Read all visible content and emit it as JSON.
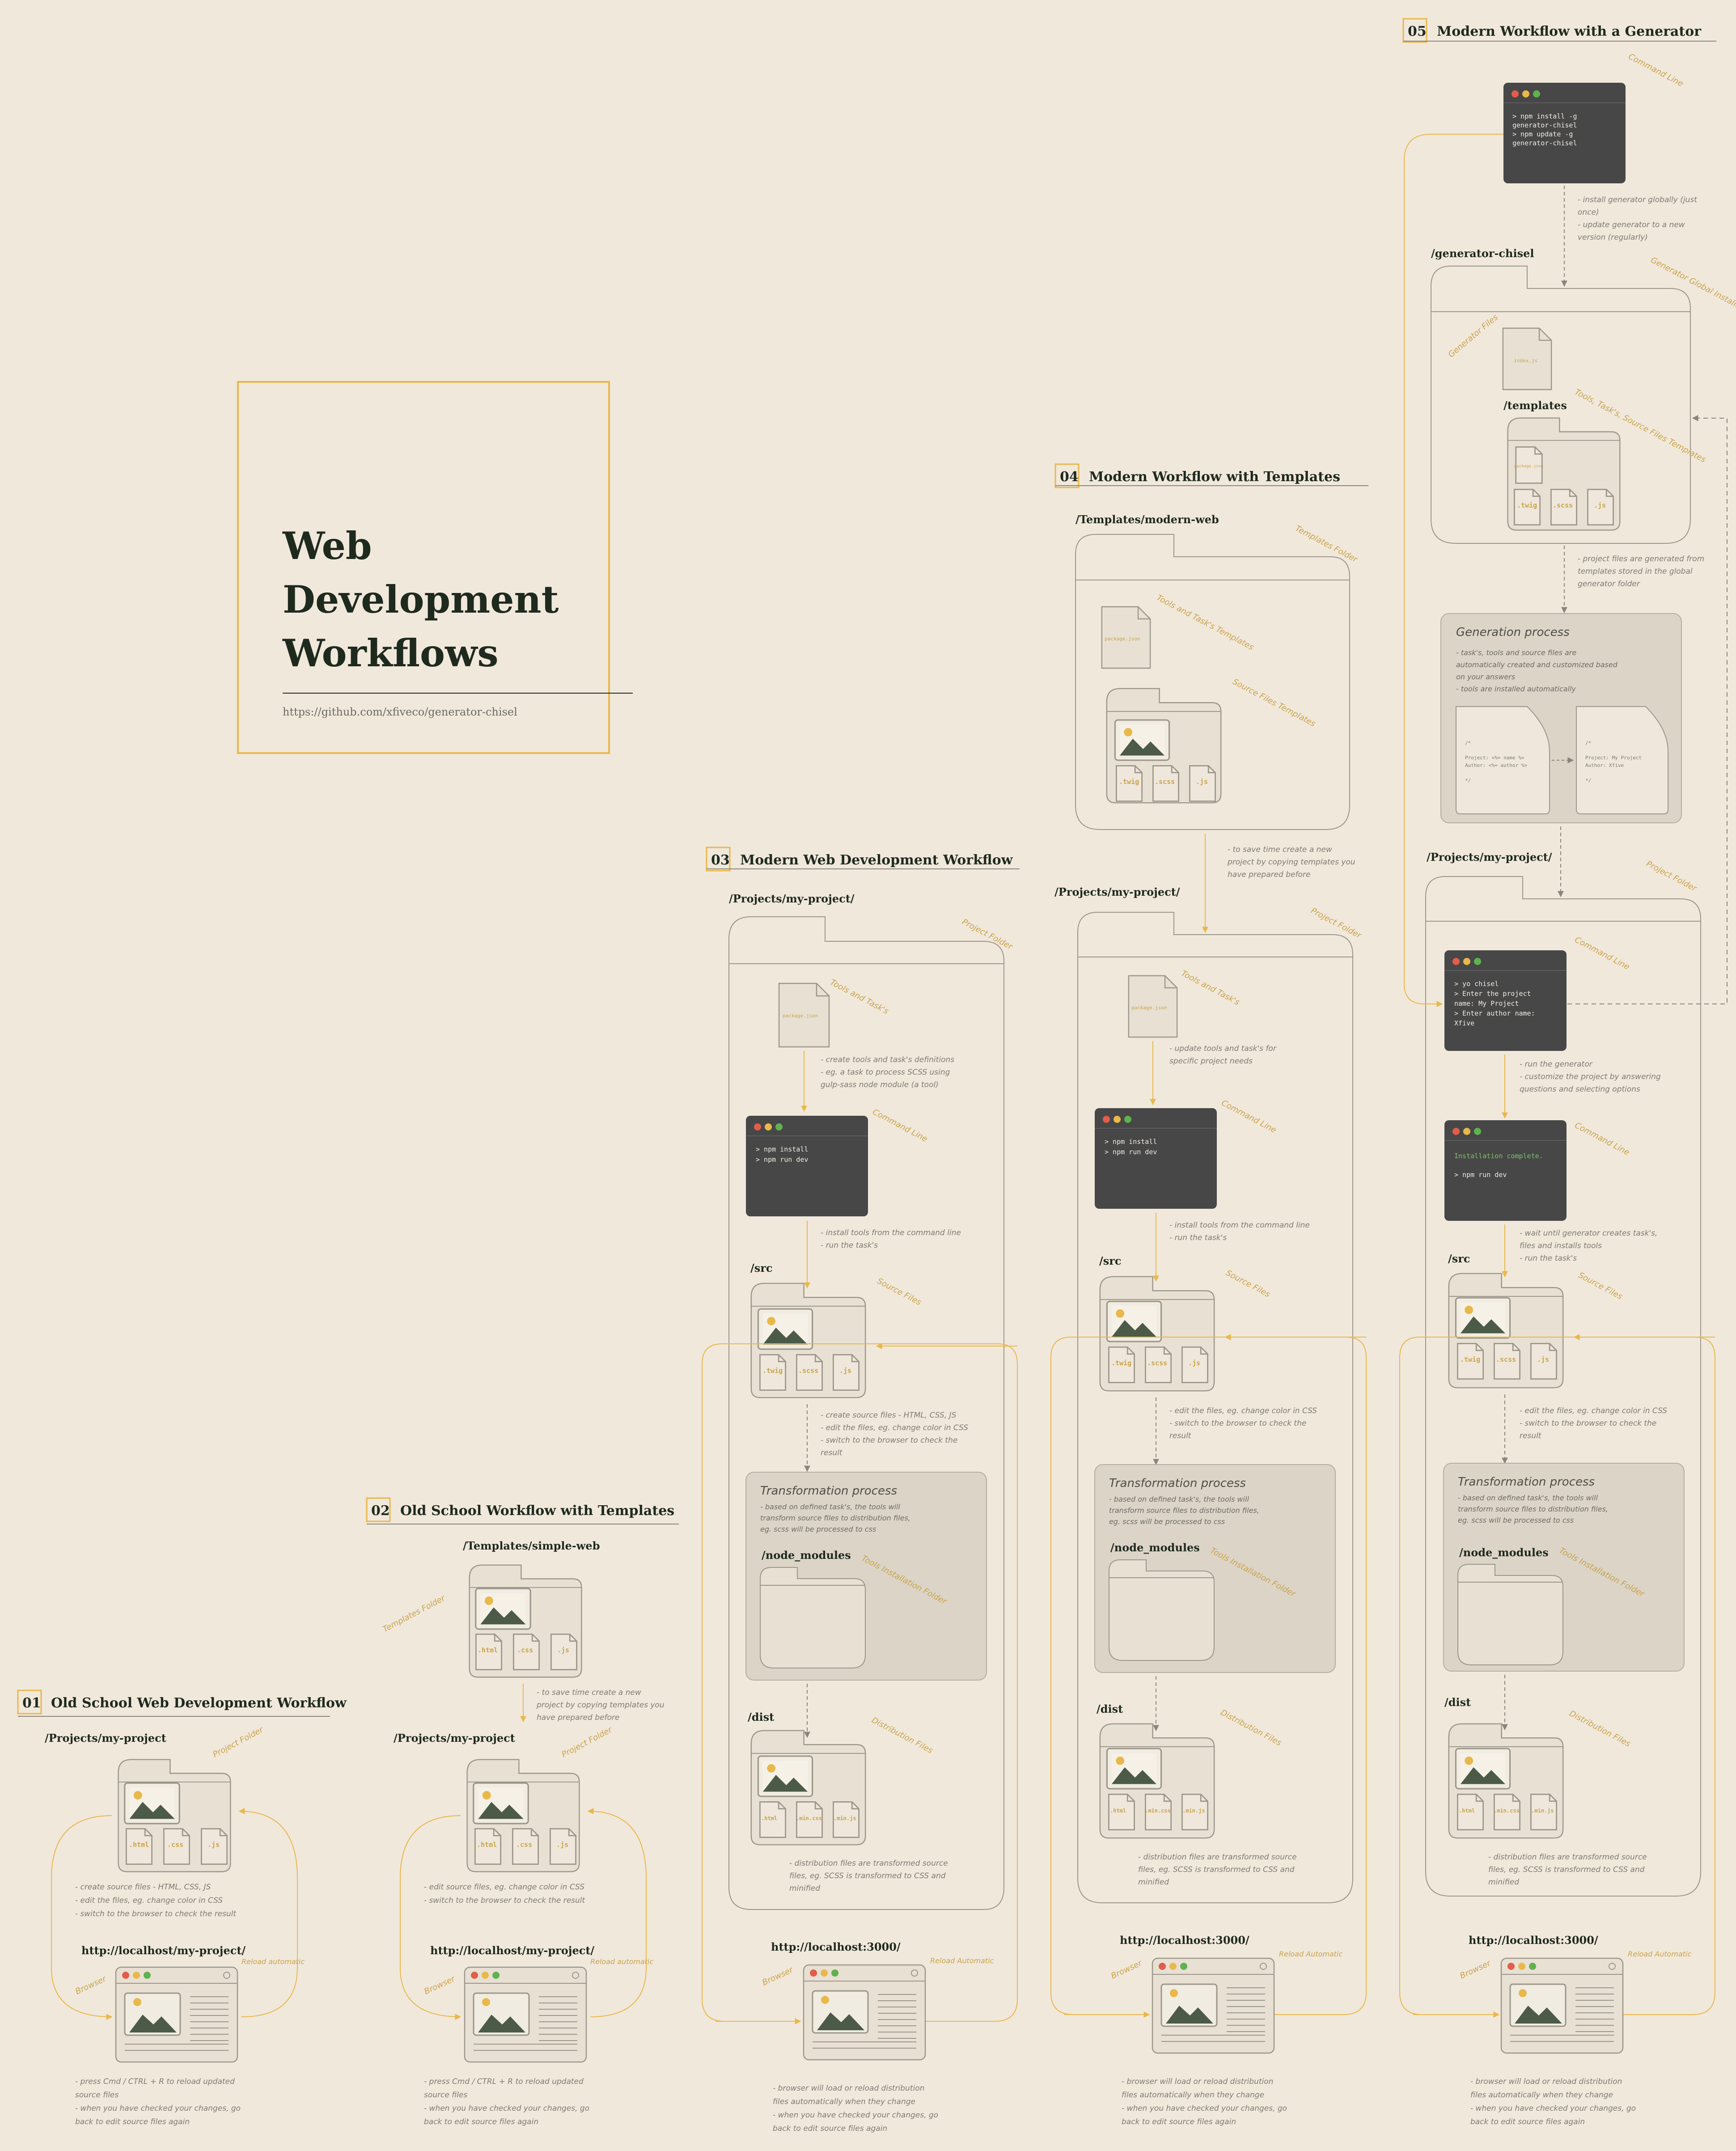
{
  "title": {
    "lines": [
      "Web",
      "Development",
      "Workflows"
    ],
    "url": "https://github.com/xfiveco/generator-chisel"
  },
  "colors": {
    "background": "#f1e8dc",
    "accent": "#e8b84a",
    "dark": "#1f2a1f",
    "terminal": "#474747",
    "folder_fill": "#e8e0d3",
    "process_fill": "#dcd4c7"
  },
  "labels": {
    "project_folder": "Project Folder",
    "templates_folder": "Templates Folder",
    "source_files": "Source Files",
    "command_line": "Command Line",
    "tools_and_tasks": "Tools and Task's",
    "tools_and_tasks_templates": "Tools and Task's Templates",
    "source_files_templates": "Source Files Templates",
    "tools_installation_folder": "Tools Installation Folder",
    "distribution_files": "Distribution Files",
    "browser": "Browser",
    "reload_automatic": "Reload automatic",
    "reload_automatic_alt": "Reload Automatic",
    "generator_files": "Generator Files",
    "generator_global_installation_folder": "Generator Global Installation Folder",
    "tools_tasks_source_files_templates": "Tools, Task's, Source Files Templates"
  },
  "files": {
    "html": ".html",
    "css": ".css",
    "js": ".js",
    "twig": ".twig",
    "scss": ".scss",
    "min_css": ".min.css",
    "min_js": ".min.js",
    "package_json": "package.json",
    "index_js": "index.js"
  },
  "sections": {
    "s01": {
      "num": "01",
      "title": "Old School Web Development Workflow",
      "project_path": "/Projects/my-project",
      "note_edit": [
        "- create source files - HTML, CSS, JS",
        "- edit the files, eg. change color in CSS",
        "- switch to the browser to check the result"
      ],
      "url": "http://localhost/my-project/",
      "note_browser": [
        "- press Cmd / CTRL + R to reload updated",
        "source files",
        "- when you have checked your changes, go",
        "back to edit source files again"
      ]
    },
    "s02": {
      "num": "02",
      "title": "Old School Workflow with Templates",
      "templates_path": "/Templates/simple-web",
      "note_copy": [
        "- to save time create a new",
        "project by copying templates you",
        "have prepared before"
      ],
      "project_path": "/Projects/my-project",
      "note_edit": [
        "- edit source files, eg. change color in CSS",
        "- switch to the browser to check the result"
      ],
      "url": "http://localhost/my-project/",
      "note_browser": [
        "- press Cmd / CTRL + R to reload updated",
        "source files",
        "- when you have checked your changes, go",
        "back to edit source files again"
      ]
    },
    "s03": {
      "num": "03",
      "title": "Modern Web Development Workflow",
      "project_path": "/Projects/my-project/",
      "note_package": [
        "- create tools and task's definitions",
        "- eg. a task to process SCSS using",
        "gulp-sass node module (a tool)"
      ],
      "terminal": [
        "> npm install",
        "> npm run dev"
      ],
      "note_terminal": [
        "- install tools from the command line",
        "- run the task's"
      ],
      "src_path": "/src",
      "note_src": [
        "- create source files - HTML, CSS, JS",
        "- edit the files, eg. change color in CSS",
        "- switch to the browser to check the",
        "result"
      ],
      "process_title": "Transformation process",
      "process_text": [
        "- based on defined task's, the tools will",
        "transform source files to distribution files,",
        "eg. scss will be processed to css"
      ],
      "node_modules": "/node_modules",
      "dist_path": "/dist",
      "note_dist": [
        "- distribution files are transformed source",
        "files, eg. SCSS is transformed to CSS and",
        "minified"
      ],
      "url": "http://localhost:3000/",
      "note_browser": [
        "- browser will load or reload distribution",
        "files automatically when they change",
        "- when you have checked your changes, go",
        "back to edit source files again"
      ]
    },
    "s04": {
      "num": "04",
      "title": "Modern Workflow with Templates",
      "templates_path": "/Templates/modern-web",
      "note_copy": [
        "- to save time create a new",
        "project by copying templates you",
        "have prepared before"
      ],
      "project_path": "/Projects/my-project/",
      "note_package": [
        "- update tools and task's for",
        "specific project needs"
      ],
      "terminal": [
        "> npm install",
        "> npm run dev"
      ],
      "note_terminal": [
        "- install tools from the command line",
        "- run the task's"
      ],
      "src_path": "/src",
      "note_src": [
        "- edit the files, eg. change color in CSS",
        "- switch to the browser to check the",
        "result"
      ],
      "process_title": "Transformation process",
      "process_text": [
        "- based on defined task's, the tools will",
        "transform source files to distribution files,",
        "eg. scss will be processed to css"
      ],
      "node_modules": "/node_modules",
      "dist_path": "/dist",
      "note_dist": [
        "- distribution files are transformed source",
        "files, eg. SCSS is transformed to CSS and",
        "minified"
      ],
      "url": "http://localhost:3000/",
      "note_browser": [
        "- browser will load or reload distribution",
        "files automatically when they change",
        "- when you have checked your changes, go",
        "back to edit source files again"
      ]
    },
    "s05": {
      "num": "05",
      "title": "Modern Workflow with a Generator",
      "terminal_install": [
        "> npm install -g",
        "generator-chisel",
        "> npm update -g",
        "generator-chisel"
      ],
      "note_install": [
        "- install generator globally (just",
        "once)",
        "- update generator to a new",
        "version (regularly)"
      ],
      "generator_path": "/generator-chisel",
      "templates_path": "/templates",
      "note_generated": [
        "- project files are generated from",
        "templates stored in the global",
        "generator folder"
      ],
      "gen_title": "Generation process",
      "gen_text": [
        "- task's, tools and source files are",
        "automatically created and customized based",
        "on your answers",
        "- tools are installed automatically"
      ],
      "code_left": [
        "/*",
        "  Project: <%= name %>",
        "  Author: <%= author %>",
        "",
        "*/"
      ],
      "code_right": [
        "/*",
        "  Project: My Project",
        "  Author: Xfive",
        "",
        "*/"
      ],
      "project_path": "/Projects/my-project/",
      "terminal_yo": [
        "> yo chisel",
        "> Enter the project",
        "name: My Project",
        "> Enter author name:",
        "Xfive"
      ],
      "note_yo": [
        "- run the generator",
        "- customize the project by answering",
        "questions and selecting options"
      ],
      "terminal_run_ok": "Installation complete.",
      "terminal_run": "> npm run dev",
      "note_run": [
        "- wait until generator creates task's,",
        "files and installs tools",
        "- run the task's"
      ],
      "src_path": "/src",
      "note_src": [
        "- edit the files, eg. change color in CSS",
        "- switch to the browser to check the",
        "result"
      ],
      "process_title": "Transformation process",
      "process_text": [
        "- based on defined task's, the tools will",
        "transform source files to distribution files,",
        "eg. scss will be processed to css"
      ],
      "node_modules": "/node_modules",
      "dist_path": "/dist",
      "note_dist": [
        "- distribution files are transformed source",
        "files, eg. SCSS is transformed to CSS and",
        "minified"
      ],
      "url": "http://localhost:3000/",
      "note_browser": [
        "- browser will load or reload distribution",
        "files automatically when they change",
        "- when you have checked your changes, go",
        "back to edit source files again"
      ]
    }
  }
}
